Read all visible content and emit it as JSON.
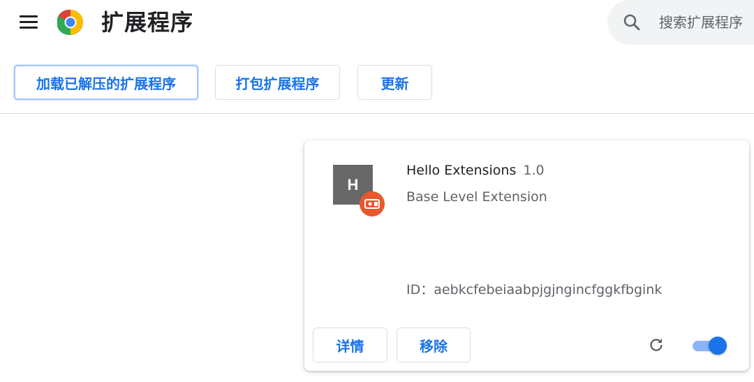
{
  "header": {
    "title": "扩展程序",
    "search_placeholder": "搜索扩展程序"
  },
  "toolbar": {
    "load_unpacked_label": "加载已解压的扩展程序",
    "pack_label": "打包扩展程序",
    "update_label": "更新"
  },
  "extension": {
    "icon_letter": "H",
    "name": "Hello Extensions",
    "version": "1.0",
    "description": "Base Level Extension",
    "id_text": "ID：aebkcfebeiaabpjgjngincfggkfbgink",
    "details_label": "详情",
    "remove_label": "移除",
    "enabled": true
  },
  "colors": {
    "accent": "#1a73e8",
    "badge": "#e8582c",
    "icon_bg": "#686868"
  }
}
